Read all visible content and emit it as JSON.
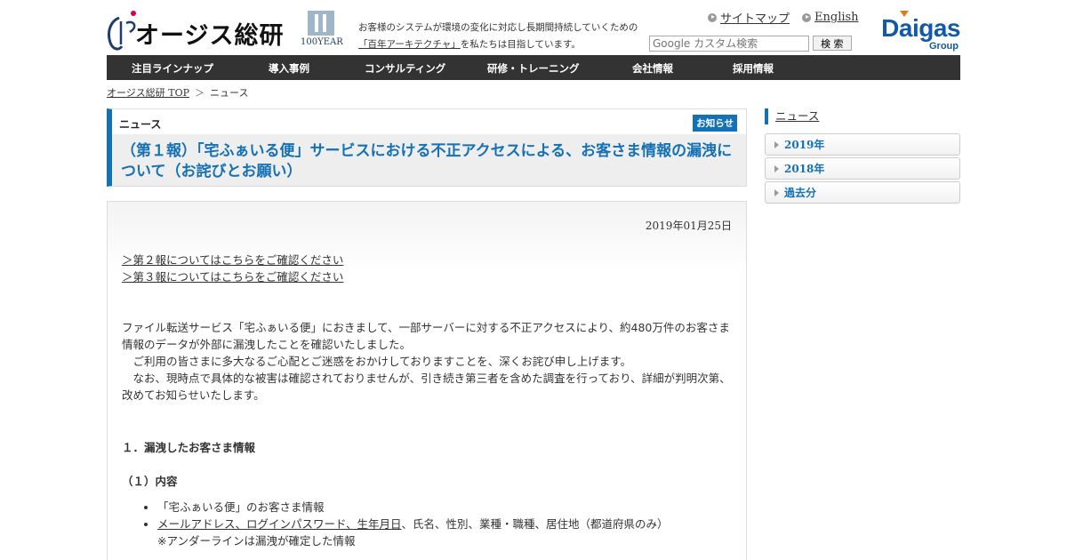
{
  "header": {
    "logo_text": "オージス総研",
    "century_text": "100YEAR",
    "tagline_line1": "お客様のシステムが環境の変化に対応し長期間持続していくための",
    "tagline_link": "「百年アーキテクチャ」",
    "tagline_line2_rest": "を私たちは目指しています。",
    "util_links": [
      "サイトマップ",
      "English"
    ],
    "search_placeholder": "Google カスタム検索",
    "search_button": "検 索",
    "group_logo_word": "Daigas",
    "group_logo_sub": "Group"
  },
  "nav": {
    "items": [
      "注目ラインナップ",
      "導入事例",
      "コンサルティング",
      "研修・トレーニング",
      "会社情報",
      "採用情報"
    ]
  },
  "breadcrumb": {
    "home": "オージス総研 TOP",
    "separator": "＞",
    "current": "ニュース"
  },
  "article": {
    "category": "ニュース",
    "badge": "お知らせ",
    "title": "（第１報）「宅ふぁいる便」サービスにおける不正アクセスによる、お客さま情報の漏洩について（お詫びとお願い）",
    "date": "2019年01月25日",
    "links": [
      "＞第２報についてはこちらをご確認ください",
      "＞第３報についてはこちらをご確認ください"
    ],
    "paragraph1": "ファイル転送サービス「宅ふぁいる便」におきまして、一部サーバーに対する不正アクセスにより、約480万件のお客さま情報のデータが外部に漏洩したことを確認いたしました。",
    "paragraph2": "　ご利用の皆さまに多大なるご心配とご迷惑をおかけしておりますことを、深くお詫び申し上げます。",
    "paragraph3": "　なお、現時点で具体的な被害は確認されておりませんが、引き続き第三者を含めた調査を行っており、詳細が判明次第、改めてお知らせいたします。",
    "section1": "１．漏洩したお客さま情報",
    "section1_sub": "（１）内容",
    "bullet1": "「宅ふぁいる便」のお客さま情報",
    "bullet2_underlined": "メールアドレス、ログインパスワード、生年月日",
    "bullet2_rest": "、氏名、性別、業種・職種、居住地（都道府県のみ）",
    "bullet2_note": "※アンダーラインは漏洩が確定した情報"
  },
  "sidebar": {
    "title": "ニュース",
    "items": [
      "2019年",
      "2018年",
      "過去分"
    ]
  },
  "colors": {
    "accent": "#1571b5",
    "nav_bg": "#333333",
    "brand_daigas": "#1259a8"
  }
}
